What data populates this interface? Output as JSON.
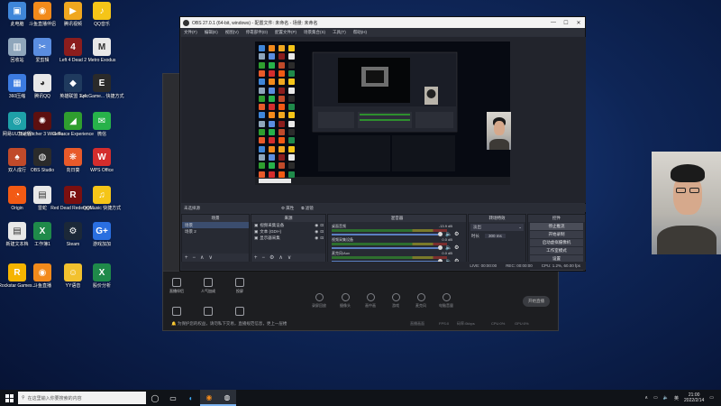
{
  "desktop_icons": [
    {
      "label": "此电脑",
      "glyph": "▣",
      "color": "#3f86d9"
    },
    {
      "label": "斗鱼直播伴侣",
      "glyph": "◉",
      "color": "#f28a1b"
    },
    {
      "label": "腾讯视频",
      "glyph": "▶",
      "color": "#f0a71f"
    },
    {
      "label": "QQ音乐",
      "glyph": "♪",
      "color": "#f5c518"
    },
    {
      "label": "回收站",
      "glyph": "▥",
      "color": "#8fa6bb"
    },
    {
      "label": "爱剪辑",
      "glyph": "✂",
      "color": "#5a8de0"
    },
    {
      "label": "Left 4 Dead 2",
      "glyph": "4",
      "color": "#8b1d1d"
    },
    {
      "label": "Metro Exodus",
      "glyph": "M",
      "color": "#e8e8e8"
    },
    {
      "label": "360压缩",
      "glyph": "▦",
      "color": "#3c7be0"
    },
    {
      "label": "腾讯QQ",
      "glyph": "◕",
      "color": "#e8e8e8"
    },
    {
      "label": "英雄联盟 1v4",
      "glyph": "◆",
      "color": "#1f3a5e"
    },
    {
      "label": "EpicGame... 快捷方式",
      "glyph": "E",
      "color": "#2a2a2a"
    },
    {
      "label": "网易UU加速器",
      "glyph": "◎",
      "color": "#1ea0a8"
    },
    {
      "label": "The Witcher 3 Wild Hu...",
      "glyph": "✺",
      "color": "#5c1010"
    },
    {
      "label": "GeForce Experience",
      "glyph": "◢",
      "color": "#2f9e2f"
    },
    {
      "label": "微信",
      "glyph": "✉",
      "color": "#27b24a"
    },
    {
      "label": "双人成行",
      "glyph": "♠",
      "color": "#c04a2a"
    },
    {
      "label": "OBS Studio",
      "glyph": "◍",
      "color": "#2b2b2b"
    },
    {
      "label": "向日葵",
      "glyph": "❋",
      "color": "#e85a2a"
    },
    {
      "label": "WPS Office",
      "glyph": "W",
      "color": "#d42d2d"
    },
    {
      "label": "Origin",
      "glyph": "◔",
      "color": "#f25a14"
    },
    {
      "label": "雷蛇",
      "glyph": "▤",
      "color": "#e8e8e8"
    },
    {
      "label": "Red Dead Redempti...",
      "glyph": "R",
      "color": "#7a1010"
    },
    {
      "label": "QQMusic 快捷方式",
      "glyph": "♫",
      "color": "#f5c518"
    },
    {
      "label": "新建文本档",
      "glyph": "▤",
      "color": "#e8e8e8"
    },
    {
      "label": "工作簿1",
      "glyph": "X",
      "color": "#1f8a4a"
    },
    {
      "label": "Steam",
      "glyph": "⚙",
      "color": "#1b2838"
    },
    {
      "label": "游戏加加",
      "glyph": "G+",
      "color": "#2a6fe0"
    },
    {
      "label": "Rockstar Games...",
      "glyph": "R",
      "color": "#f5b400"
    },
    {
      "label": "斗鱼直播",
      "glyph": "◉",
      "color": "#f28a1b"
    },
    {
      "label": "YY语音",
      "glyph": "☺",
      "color": "#f2c12e"
    },
    {
      "label": "股价分析",
      "glyph": "X",
      "color": "#1f8a4a"
    }
  ],
  "background_app": {
    "tools": [
      {
        "label": "直播伴侣",
        "icon": "broadcast-icon"
      },
      {
        "label": "人气加成",
        "icon": "flame-icon"
      },
      {
        "label": "投屏",
        "icon": "screen-icon"
      }
    ],
    "bottom_tools": [
      {
        "label": "",
        "icon": "triangle-icon"
      },
      {
        "label": "",
        "icon": "chart-icon"
      },
      {
        "label": "",
        "icon": "download-icon"
      }
    ],
    "actions": [
      "录屏回放",
      "摄像头",
      "画中画",
      "游戏",
      "麦克风",
      "电脑音量"
    ],
    "start_button": "开始直播",
    "notice": "🔔 为保护您的权益，请勿私下交易，直播规范信息，更上一层楼",
    "stats": [
      "直播画面",
      "FPS:0",
      "码率:0kbps",
      "CPU:0%",
      "GPU:0%"
    ]
  },
  "obs": {
    "title": "OBS 27.0.1 (64-bit, windows) - 配置文件: 未命名 - 场景: 未命名",
    "menu": [
      "文件(F)",
      "编辑(E)",
      "视图(V)",
      "停靠部件(D)",
      "配置文件(P)",
      "场景集合(S)",
      "工具(T)",
      "帮助(H)"
    ],
    "scene_bar": {
      "label": "未选择源",
      "properties": "⚙ 属性",
      "filters": "⧉ 滤镜"
    },
    "scenes": {
      "header": "场景",
      "items": [
        "场景",
        "场景 2"
      ]
    },
    "sources": {
      "header": "来源",
      "items": [
        "视频采集设备",
        "文本 (GDI+)",
        "显示器采集"
      ]
    },
    "mixer": {
      "header": "混音器",
      "tracks": [
        {
          "name": "桌面音频",
          "db": "-13.9 dB"
        },
        {
          "name": "视频采集设备",
          "db": "0.0 dB"
        },
        {
          "name": "麦克风/Aux",
          "db": "0.0 dB"
        }
      ]
    },
    "transitions": {
      "header": "转场特效",
      "type": "淡出",
      "duration_label": "时长",
      "duration_value": "300 ms"
    },
    "controls": {
      "header": "控件",
      "buttons": [
        "停止推流",
        "开始录制",
        "启动虚拟摄像机",
        "工作室模式",
        "设置",
        "退出"
      ]
    },
    "status": [
      "LIVE: 00:00:00",
      "REC: 00:00:00",
      "CPU: 1.2%, 60.00 fps"
    ]
  },
  "taskbar": {
    "search_placeholder": "在这里输入你要搜索的内容",
    "apps": [
      "task-view-icon",
      "edge-icon",
      "douyu-icon",
      "obs-icon"
    ],
    "ime": "英",
    "time": "21:00",
    "date": "2022/2/14"
  }
}
